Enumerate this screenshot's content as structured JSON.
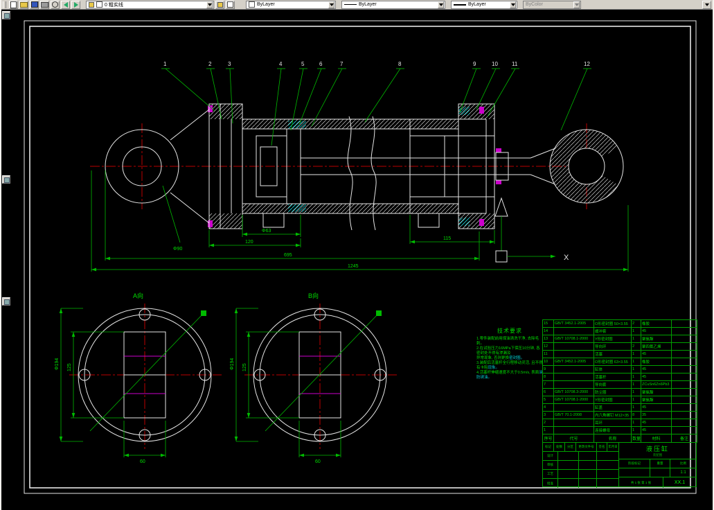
{
  "toolbar": {
    "layer": "0 粗实线",
    "color": "ByLayer",
    "linetype": "ByLayer",
    "lineweight": "ByLayer",
    "plotstyle": "ByColor"
  },
  "drawing": {
    "callouts": [
      "1",
      "2",
      "3",
      "4",
      "5",
      "6",
      "7",
      "8",
      "9",
      "10",
      "11",
      "12"
    ],
    "axis_label": "X",
    "view_a_label": "A向",
    "view_b_label": "B向",
    "dims": {
      "bore": "Φ63",
      "flange_len": "120",
      "head_len": "115",
      "body_len": "695",
      "overall_len": "1245",
      "eye_dia": "Φ90",
      "view_outer": "Φ194",
      "view_rect_h": "125",
      "view_rect_w": "60"
    },
    "tech": {
      "title": "技术要求",
      "items": [
        {
          "text": "1.零件装配前用煤油清洗干净, 去除毛刺。",
          "accent": ""
        },
        {
          "text": "2.在试验压力16MPa下保压10分钟, 各密封处不得有渗漏及",
          "accent": ""
        },
        {
          "text": "  异常现象, 否则更换",
          "accent": "密封圈。"
        },
        {
          "text": "3.装配后活塞杆全行程移动灵活, 且不得有卡阻",
          "accent": "现象。"
        },
        {
          "text": "4.活塞杆伸缩速度不大于0.5m/s, 表面",
          "accent": "涂防锈油。"
        }
      ]
    }
  },
  "bom": {
    "headers": [
      "序号",
      "代号",
      "名称",
      "数量",
      "材料",
      "备注"
    ],
    "rows": [
      [
        "15",
        "GB/T 3452.1-2005",
        "O形密封圈 50×3.55",
        "2",
        "橡胶",
        ""
      ],
      [
        "14",
        "",
        "缓冲套",
        "1",
        "45",
        ""
      ],
      [
        "13",
        "GB/T 10708.1-2000",
        "Y形密封圈",
        "1",
        "聚氨酯",
        ""
      ],
      [
        "12",
        "",
        "导向环",
        "2",
        "聚四氟乙烯",
        ""
      ],
      [
        "11",
        "",
        "活塞",
        "1",
        "45",
        ""
      ],
      [
        "10",
        "GB/T 3452.1-2005",
        "O形密封圈 63×3.55",
        "1",
        "橡胶",
        ""
      ],
      [
        "9",
        "",
        "缸体",
        "1",
        "45",
        ""
      ],
      [
        "8",
        "",
        "活塞杆",
        "1",
        "45",
        ""
      ],
      [
        "7",
        "",
        "导向套",
        "1",
        "ZCuSn6Zn6Pb3",
        ""
      ],
      [
        "6",
        "GB/T 10708.3-2000",
        "防尘圈",
        "1",
        "聚氨酯",
        ""
      ],
      [
        "5",
        "GB/T 10708.1-2000",
        "Y形密封圈",
        "1",
        "聚氨酯",
        ""
      ],
      [
        "4",
        "",
        "缸盖",
        "1",
        "45",
        ""
      ],
      [
        "3",
        "GB/T 70.1-2008",
        "内六角螺钉 M12×35",
        "8",
        "35",
        ""
      ],
      [
        "2",
        "",
        "耳环",
        "1",
        "45",
        ""
      ],
      [
        "1",
        "",
        "连接螺母",
        "1",
        "45",
        ""
      ]
    ]
  },
  "title_block": {
    "name": "液压缸",
    "doc_type": "装配图",
    "stage_label": "阶段标记",
    "weight_label": "重量",
    "scale_label": "比例",
    "scale": "1:1",
    "sheet": "共 1 张 第 1 张",
    "drawing_no": "XX.1",
    "rev_labels": [
      "标记",
      "处数",
      "分区",
      "更改文件号",
      "签名",
      "年月日"
    ],
    "sign_rows": [
      "设计",
      "审核",
      "工艺",
      "批准"
    ]
  }
}
